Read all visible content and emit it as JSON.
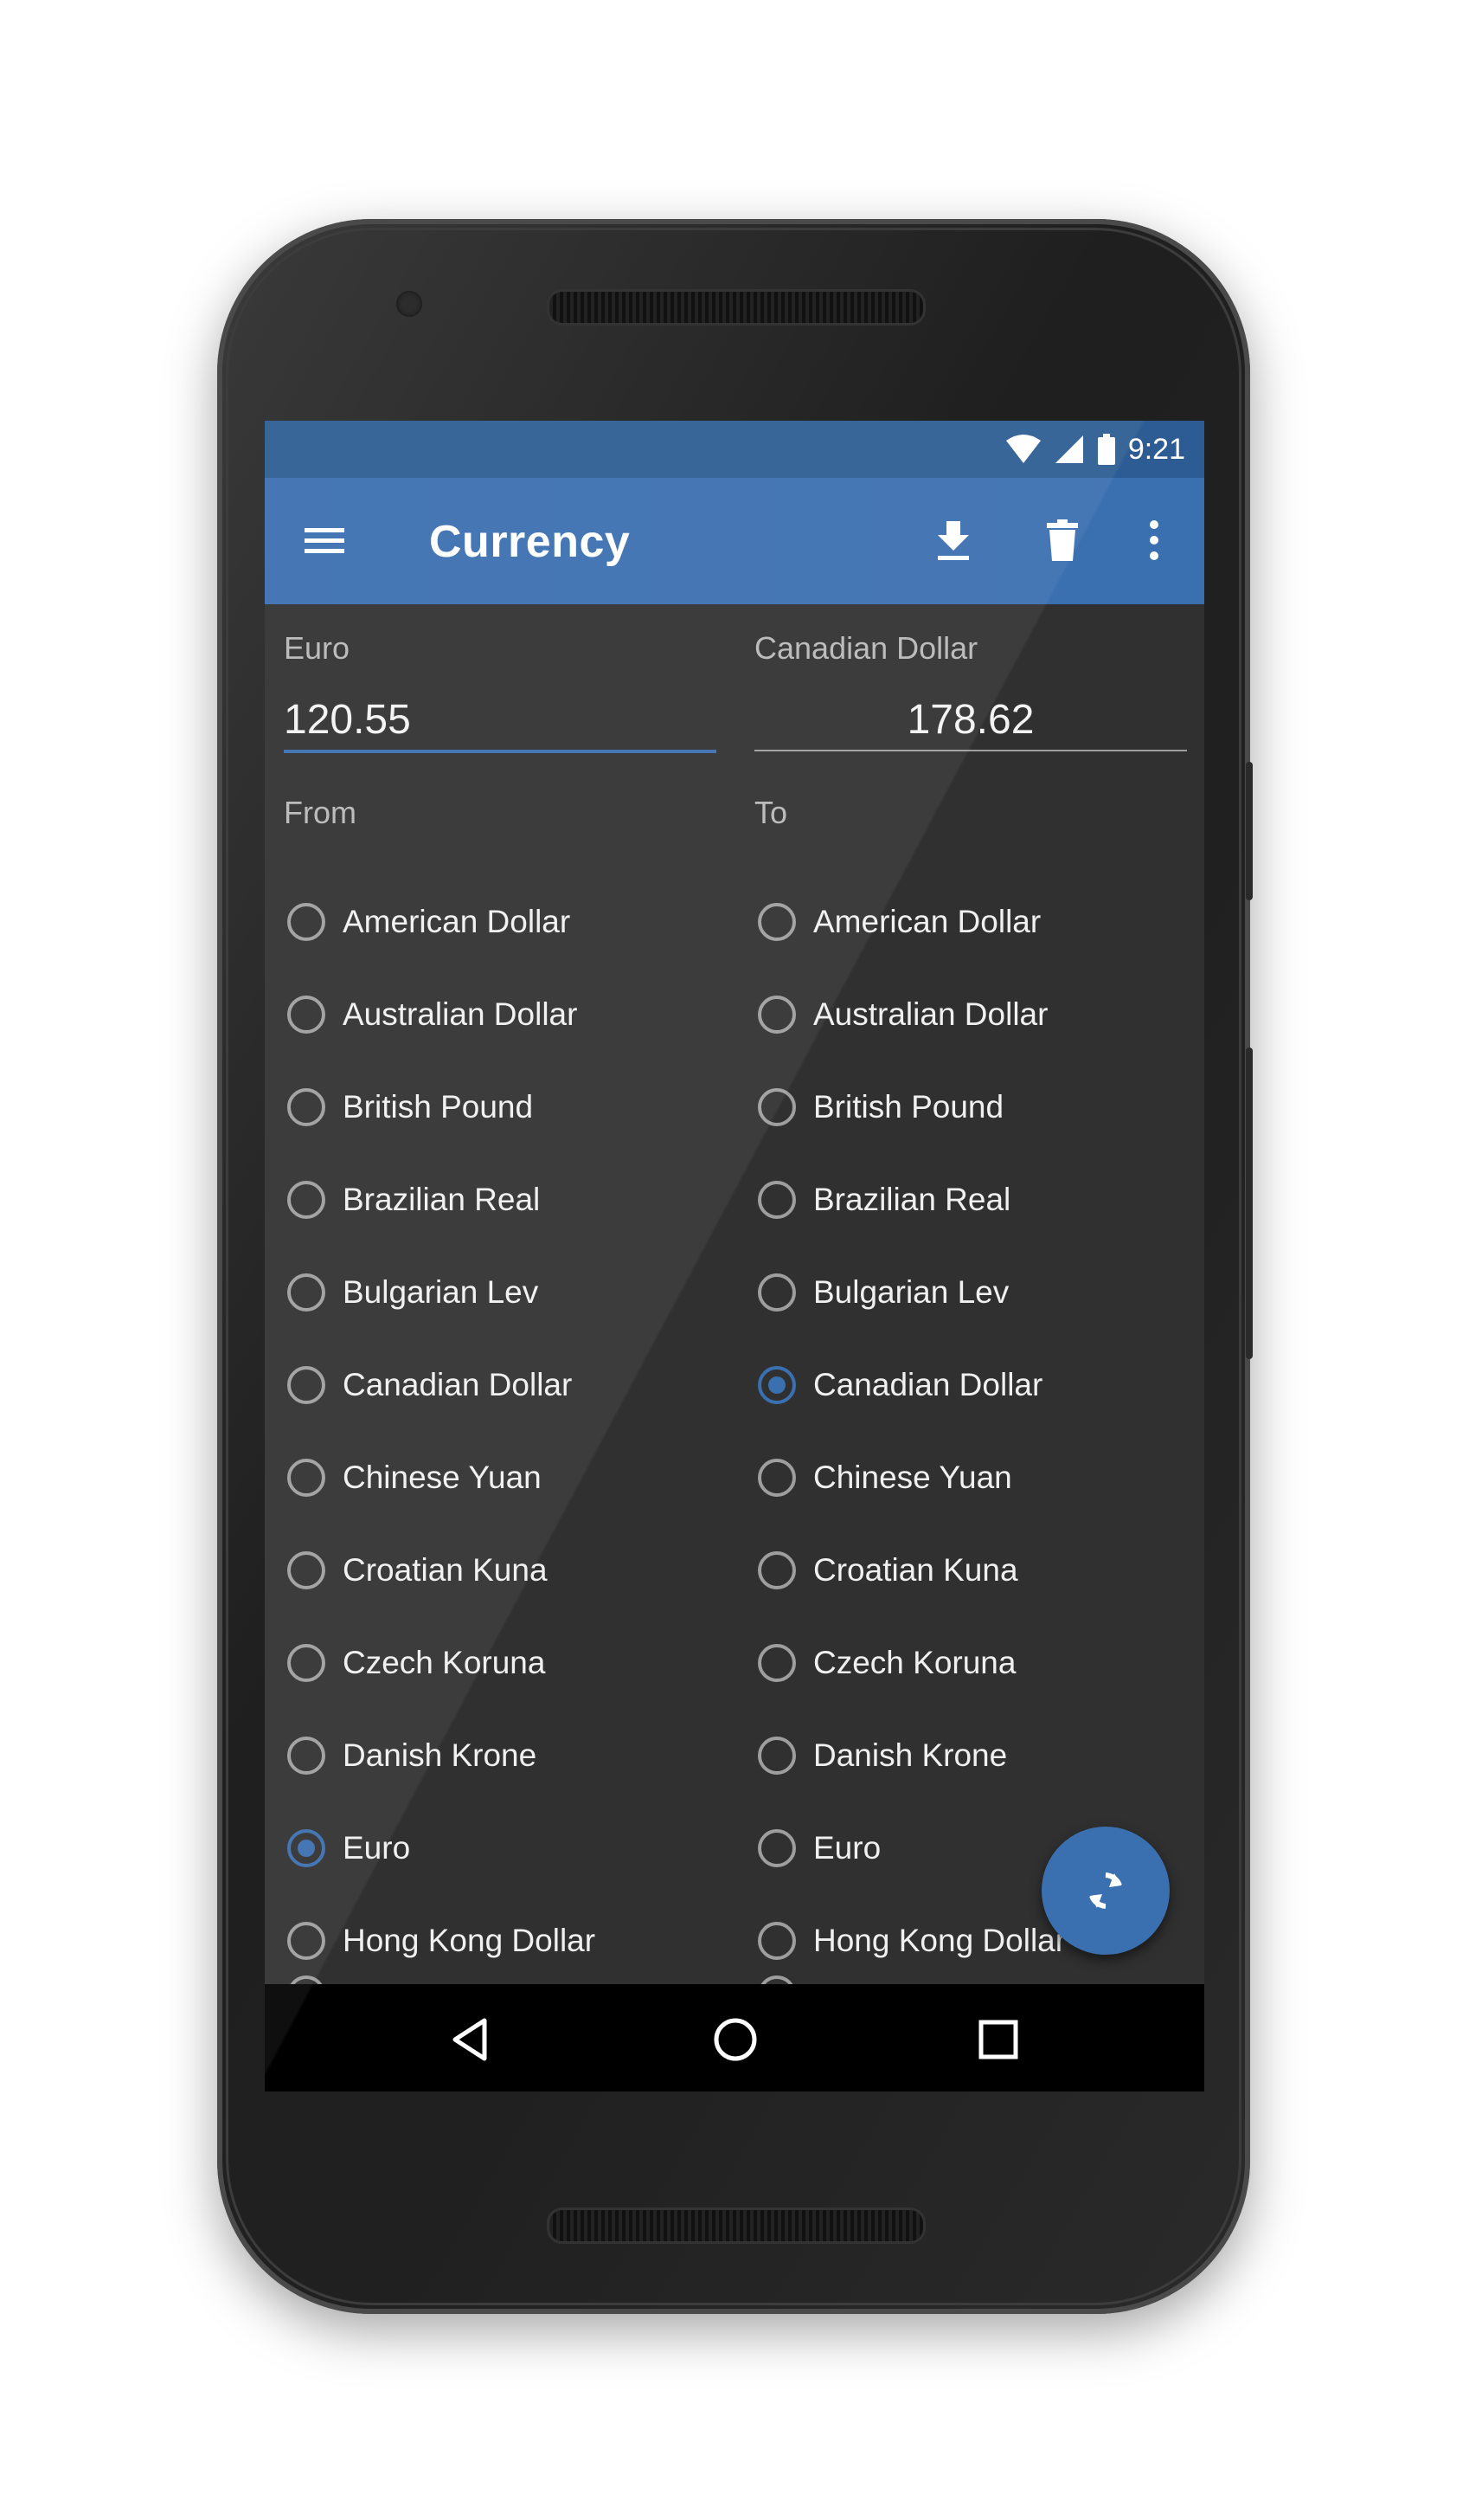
{
  "status_bar": {
    "time": "9:21"
  },
  "app_bar": {
    "title": "Currency",
    "actions": [
      "download-icon",
      "delete-icon",
      "more-vert-icon"
    ]
  },
  "from_field": {
    "label": "Euro",
    "value": "120.55"
  },
  "to_field": {
    "label": "Canadian Dollar",
    "value": "178.62"
  },
  "from_section": {
    "label": "From",
    "selected": "Euro",
    "options": [
      "American Dollar",
      "Australian Dollar",
      "British Pound",
      "Brazilian Real",
      "Bulgarian Lev",
      "Canadian Dollar",
      "Chinese Yuan",
      "Croatian Kuna",
      "Czech Koruna",
      "Danish Krone",
      "Euro",
      "Hong Kong Dollar"
    ]
  },
  "to_section": {
    "label": "To",
    "selected": "Canadian Dollar",
    "options": [
      "American Dollar",
      "Australian Dollar",
      "British Pound",
      "Brazilian Real",
      "Bulgarian Lev",
      "Canadian Dollar",
      "Chinese Yuan",
      "Croatian Kuna",
      "Czech Koruna",
      "Danish Krone",
      "Euro",
      "Hong Kong Dollar"
    ]
  },
  "fab": {
    "icon": "refresh-icon"
  },
  "nav_bar": {
    "buttons": [
      "back-icon",
      "home-icon",
      "recents-icon"
    ]
  },
  "colors": {
    "primary": "#3a6fb0",
    "status_bar": "#2c5c93",
    "background": "#303030"
  }
}
